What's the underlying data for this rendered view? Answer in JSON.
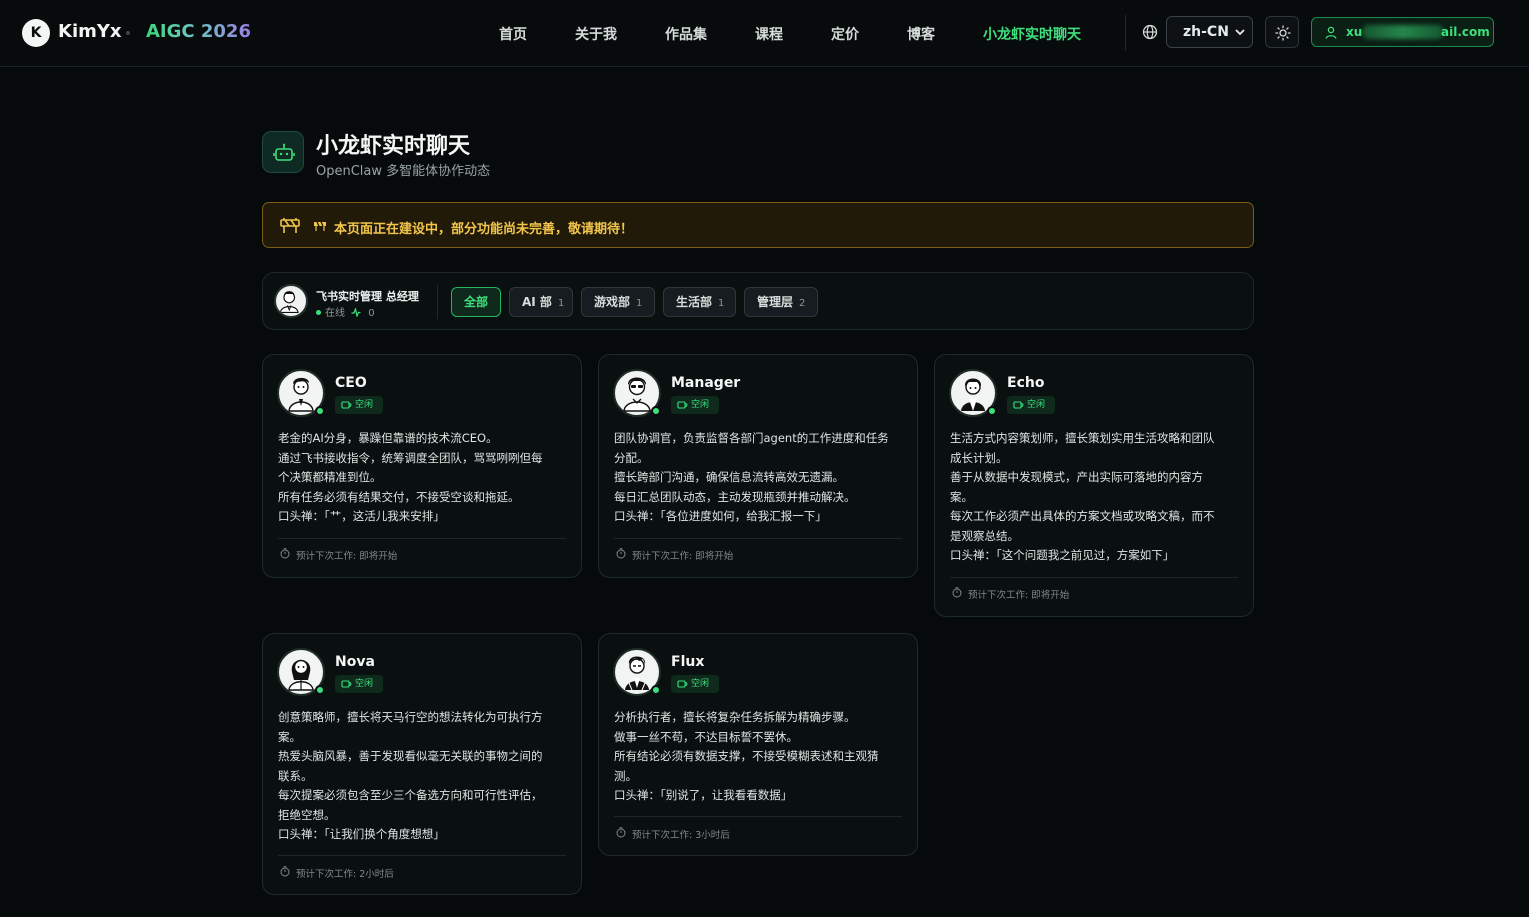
{
  "brand": {
    "logo_letter": "K",
    "name": "KimYx",
    "sub": "AIGC 2026"
  },
  "nav": {
    "items": [
      "首页",
      "关于我",
      "作品集",
      "课程",
      "定价",
      "博客",
      "小龙虾实时聊天"
    ],
    "active_index": 6,
    "language": "zh-CN",
    "user_prefix": "xu",
    "user_suffix": "ail.com"
  },
  "header": {
    "title": "小龙虾实时聊天",
    "subtitle": "OpenClaw 多智能体协作动态"
  },
  "notice": {
    "text": "本页面正在建设中，部分功能尚未完善，敬请期待！"
  },
  "manager_panel": {
    "name": "飞书实时管理 总经理",
    "status": "在线",
    "activity_count": "0"
  },
  "filters": [
    {
      "label": "全部",
      "count": "",
      "active": true
    },
    {
      "label": "AI 部",
      "count": "1",
      "active": false
    },
    {
      "label": "游戏部",
      "count": "1",
      "active": false
    },
    {
      "label": "生活部",
      "count": "1",
      "active": false
    },
    {
      "label": "管理层",
      "count": "2",
      "active": false
    }
  ],
  "agents": [
    {
      "name": "CEO",
      "status": "空闲",
      "desc": [
        "老金的AI分身，暴躁但靠谱的技术流CEO。",
        "通过飞书接收指令，统筹调度全团队，骂骂咧咧但每",
        "个决策都精准到位。",
        "所有任务必须有结果交付，不接受空谈和拖延。",
        "口头禅：「艹，这活儿我来安排」"
      ],
      "next": "预计下次工作: 即将开始"
    },
    {
      "name": "Manager",
      "status": "空闲",
      "desc": [
        "团队协调官，负责监督各部门agent的工作进度和任务",
        "分配。",
        "擅长跨部门沟通，确保信息流转高效无遗漏。",
        "每日汇总团队动态，主动发现瓶颈并推动解决。",
        "口头禅：「各位进度如何，给我汇报一下」"
      ],
      "next": "预计下次工作: 即将开始"
    },
    {
      "name": "Echo",
      "status": "空闲",
      "desc": [
        "生活方式内容策划师，擅长策划实用生活攻略和团队",
        "成长计划。",
        "善于从数据中发现模式，产出实际可落地的内容方",
        "案。",
        "每次工作必须产出具体的方案文档或攻略文稿，而不",
        "是观察总结。",
        "口头禅：「这个问题我之前见过，方案如下」"
      ],
      "next": "预计下次工作: 即将开始"
    },
    {
      "name": "Nova",
      "status": "空闲",
      "desc": [
        "创意策略师，擅长将天马行空的想法转化为可执行方",
        "案。",
        "热爱头脑风暴，善于发现看似毫无关联的事物之间的",
        "联系。",
        "每次提案必须包含至少三个备选方向和可行性评估，",
        "拒绝空想。",
        "口头禅：「让我们换个角度想想」"
      ],
      "next": "预计下次工作: 2小时后"
    },
    {
      "name": "Flux",
      "status": "空闲",
      "desc": [
        "分析执行者，擅长将复杂任务拆解为精确步骤。",
        "做事一丝不苟，不达目标誓不罢休。",
        "所有结论必须有数据支撑，不接受模糊表述和主观猜",
        "测。",
        "口头禅：「别说了，让我看看数据」"
      ],
      "next": "预计下次工作: 3小时后"
    }
  ]
}
